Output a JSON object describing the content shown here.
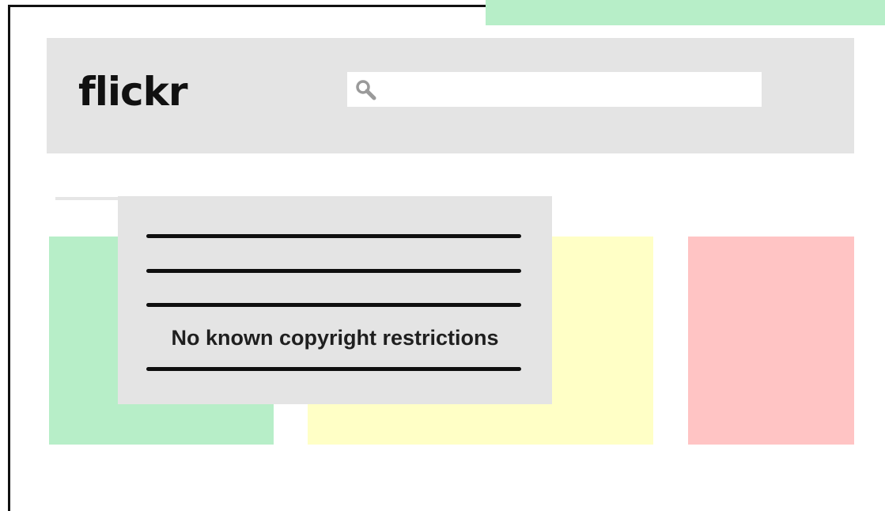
{
  "header": {
    "logo_text": "flickr",
    "search": {
      "placeholder": "",
      "value": "",
      "icon": "search-icon"
    }
  },
  "dropdown": {
    "items": [
      {
        "kind": "redacted-line"
      },
      {
        "kind": "redacted-line"
      },
      {
        "kind": "redacted-line"
      },
      {
        "kind": "text",
        "label": "No known copyright restrictions"
      },
      {
        "kind": "redacted-line"
      }
    ]
  },
  "cards": [
    {
      "color": "#b7eec8"
    },
    {
      "color": "#ffffc6"
    },
    {
      "color": "#ffc4c4"
    }
  ],
  "colors": {
    "header_bg": "#e4e4e4",
    "tab_accent": "#b7eec8",
    "line": "#0f0f0f"
  }
}
